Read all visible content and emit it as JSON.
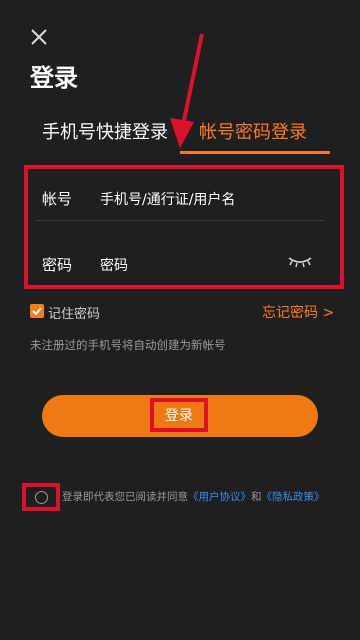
{
  "header": {
    "close_icon": "close-icon",
    "title": "登录"
  },
  "tabs": [
    {
      "label": "手机号快捷登录",
      "active": false
    },
    {
      "label": "帐号密码登录",
      "active": true
    }
  ],
  "form": {
    "account_label": "帐号",
    "account_placeholder": "手机号/通行证/用户名",
    "password_label": "密码",
    "password_placeholder": "密码",
    "eye_icon": "eye-closed-icon"
  },
  "options": {
    "remember_label": "记住密码",
    "remember_checked": true,
    "forgot_label": "忘记密码 >"
  },
  "hint": "未注册过的手机号将自动创建为新帐号",
  "login_button": "登录",
  "agreement": {
    "prefix": "登录即代表您已阅读并同意",
    "user_agreement": "《用户协议》",
    "and": "和",
    "privacy_policy": "《隐私政策》"
  },
  "colors": {
    "accent": "#ff7a1a",
    "background": "#1e1f21",
    "annotation": "#e0102a",
    "link": "#3a8ee6"
  }
}
